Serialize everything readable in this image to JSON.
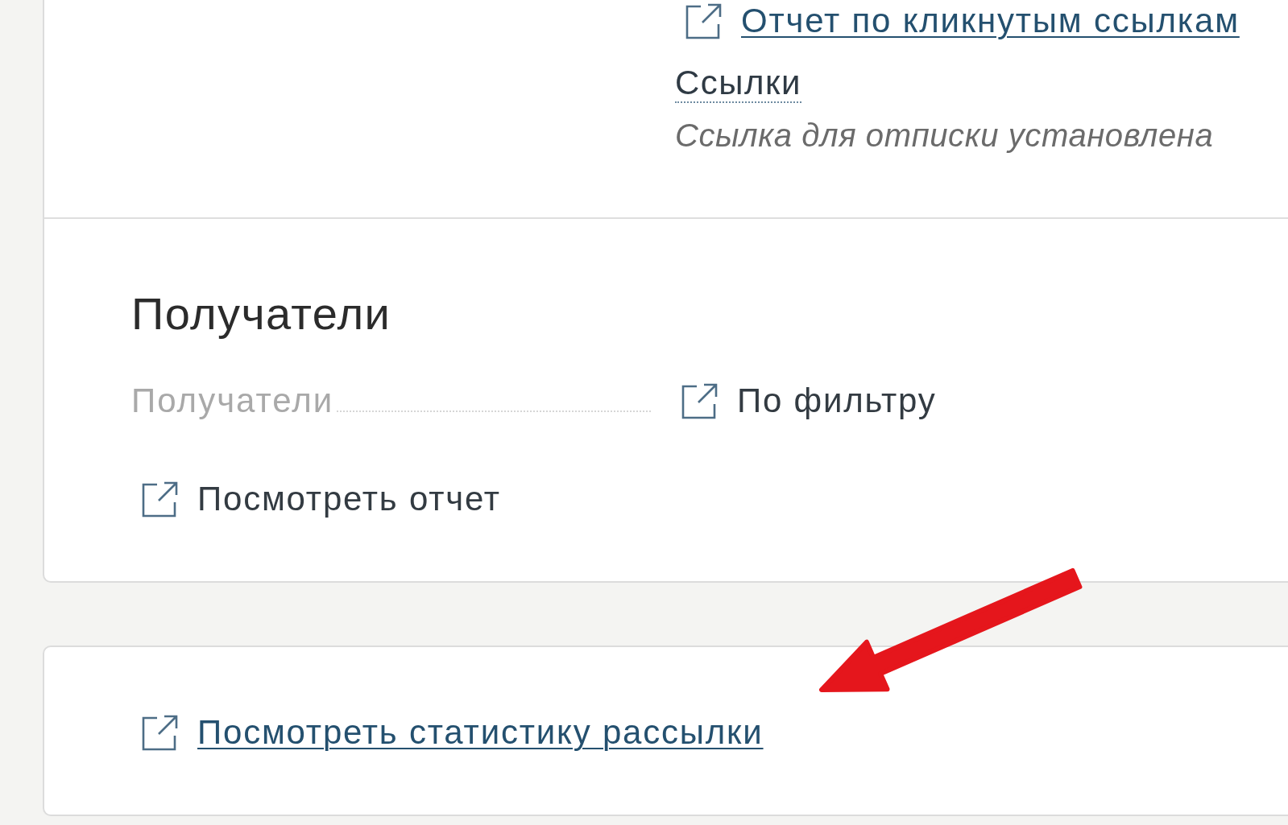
{
  "links_section": {
    "report_link": "Отчет по кликнутым ссылкам",
    "links_label": "Ссылки",
    "unsubscribe_note": "Ссылка для отписки установлена"
  },
  "recipients_section": {
    "title": "Получатели",
    "fields": [
      {
        "label": "Получатели",
        "value": "По фильтру"
      }
    ],
    "report_link": "Посмотреть отчет"
  },
  "stats_card": {
    "link": "Посмотреть статистику рассылки"
  }
}
